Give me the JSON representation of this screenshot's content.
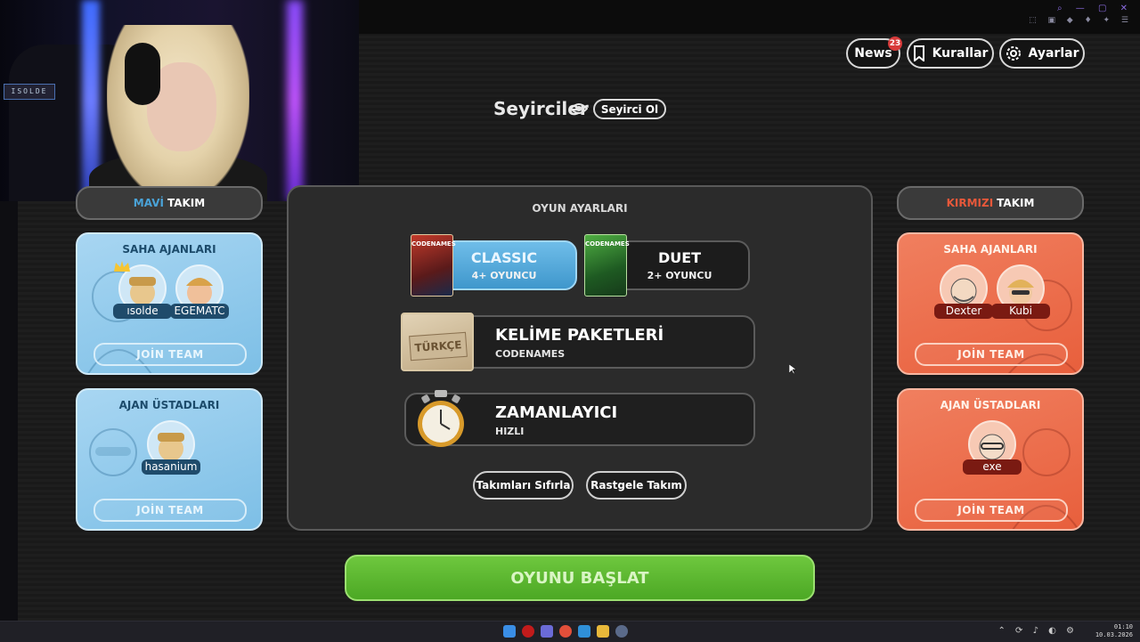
{
  "header": {
    "news_label": "News",
    "news_badge": "23",
    "rules_label": "Kurallar",
    "settings_label": "Ayarlar"
  },
  "spectators": {
    "title": "Seyirciler",
    "join_label": "Seyirci Ol"
  },
  "blue_team": {
    "title_colored": "MAVİ",
    "title_rest": "TAKIM",
    "color": "#4aa3d8",
    "operatives": {
      "title": "SAHA AJANLARI",
      "players": [
        "ısolde",
        "EGEMATC"
      ],
      "join_label": "JOİN TEAM"
    },
    "spymasters": {
      "title": "AJAN ÜSTADLARI",
      "players": [
        "hasanium"
      ],
      "join_label": "JOİN TEAM"
    }
  },
  "red_team": {
    "title_colored": "KIRMIZI",
    "title_rest": "TAKIM",
    "color": "#e8583a",
    "operatives": {
      "title": "SAHA AJANLARI",
      "players": [
        "Dexter",
        "Kubi"
      ],
      "join_label": "JOİN TEAM"
    },
    "spymasters": {
      "title": "AJAN ÜSTADLARI",
      "players": [
        "exe"
      ],
      "join_label": "JOİN TEAM"
    }
  },
  "settings": {
    "title": "OYUN AYARLARI",
    "modes": [
      {
        "name": "CLASSIC",
        "sub": "4+ OYUNCU",
        "selected": true
      },
      {
        "name": "DUET",
        "sub": "2+ OYUNCU",
        "selected": false
      }
    ],
    "box_label": "CODENAMES",
    "word_packs": {
      "name": "KELİME PAKETLERİ",
      "sub": "CODENAMES",
      "tag": "TÜRKÇE"
    },
    "timer": {
      "name": "ZAMANLAYICI",
      "sub": "HIZLI"
    },
    "reset_label": "Takımları Sıfırla",
    "random_label": "Rastgele Takım"
  },
  "start_label": "OYUNU BAŞLAT",
  "webcam_sign": "ISOLDE",
  "taskbar": {
    "time": "01:10",
    "date": "10.03.2026"
  },
  "colors": {
    "accent_blue": "#6fbde9",
    "accent_green": "#5cb832",
    "accent_red": "#e85f3c"
  }
}
